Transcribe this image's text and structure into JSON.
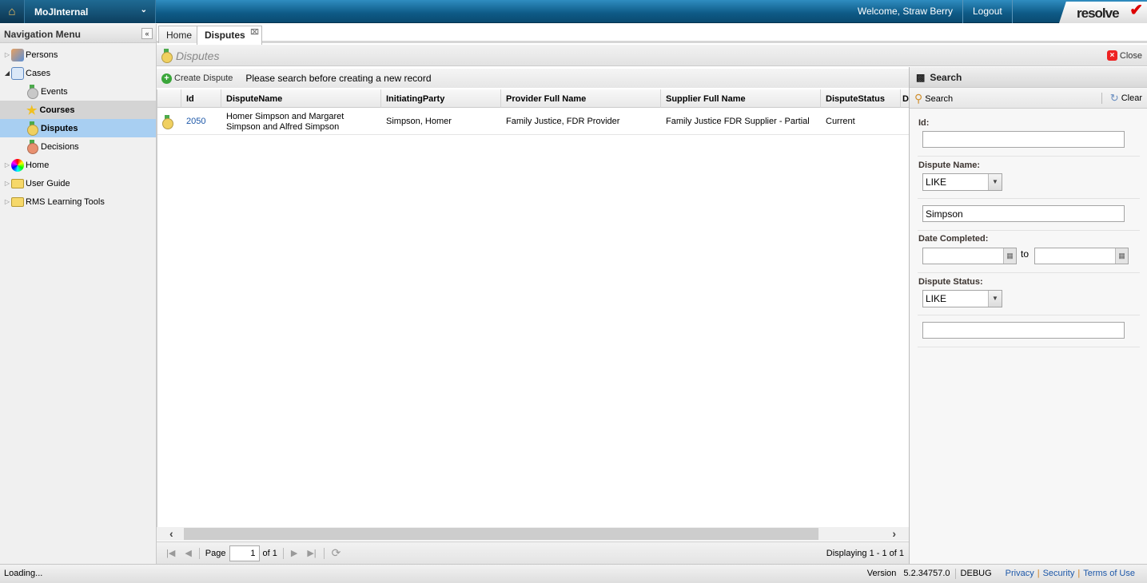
{
  "topbar": {
    "app": "MoJInternal",
    "welcome": "Welcome, Straw Berry",
    "logout": "Logout",
    "logo": "resolve"
  },
  "sidebar": {
    "title": "Navigation Menu",
    "items": [
      {
        "label": "Persons",
        "icon": "persons-icon"
      },
      {
        "label": "Cases",
        "icon": "cases-icon"
      },
      {
        "label": "Events",
        "icon": "medal-grey-icon"
      },
      {
        "label": "Courses",
        "icon": "star-icon"
      },
      {
        "label": "Disputes",
        "icon": "medal-gold-icon"
      },
      {
        "label": "Decisions",
        "icon": "medal-orange-icon"
      },
      {
        "label": "Home",
        "icon": "color-wheel-icon"
      },
      {
        "label": "User Guide",
        "icon": "folder-icon"
      },
      {
        "label": "RMS Learning Tools",
        "icon": "folder-icon"
      }
    ]
  },
  "tabs": [
    {
      "label": "Home"
    },
    {
      "label": "Disputes"
    }
  ],
  "panel": {
    "title": "Disputes",
    "close": "Close"
  },
  "toolbar": {
    "create": "Create Dispute",
    "message": "Please search before creating a new record"
  },
  "grid": {
    "columns": [
      "Id",
      "DisputeName",
      "InitiatingParty",
      "Provider Full Name",
      "Supplier Full Name",
      "DisputeStatus",
      "D"
    ],
    "rows": [
      {
        "id": "2050",
        "name": "Homer Simpson and Margaret Simpson and Alfred Simpson",
        "initiating": "Simpson, Homer",
        "provider": "Family Justice, FDR Provider",
        "supplier": "Family Justice FDR Supplier - Partial",
        "status": "Current"
      }
    ]
  },
  "pager": {
    "page_label": "Page",
    "page": "1",
    "of": "of 1",
    "displaying": "Displaying 1 - 1 of 1"
  },
  "search": {
    "title": "Search",
    "search_btn": "Search",
    "clear_btn": "Clear",
    "id_label": "Id:",
    "id_value": "",
    "name_label": "Dispute Name:",
    "name_op": "LIKE",
    "name_value": "Simpson",
    "date_label": "Date Completed:",
    "date_from": "",
    "to": "to",
    "date_to": "",
    "status_label": "Dispute Status:",
    "status_op": "LIKE",
    "status_value": ""
  },
  "status": {
    "loading": "Loading...",
    "version_label": "Version",
    "version": "5.2.34757.0",
    "debug": "DEBUG",
    "privacy": "Privacy",
    "security": "Security",
    "terms": "Terms of Use"
  },
  "colors": {
    "topbar": "#0e5a86",
    "selected": "#a8cff2",
    "link": "#1c57a8"
  }
}
